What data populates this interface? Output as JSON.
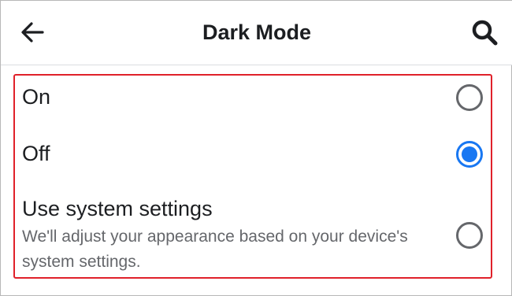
{
  "header": {
    "title": "Dark Mode",
    "back_icon": "arrow-left-icon",
    "search_icon": "search-icon"
  },
  "options": [
    {
      "label": "On",
      "description": "",
      "selected": false
    },
    {
      "label": "Off",
      "description": "",
      "selected": true
    },
    {
      "label": "Use system settings",
      "description": "We'll adjust your appearance based on your device's system settings.",
      "selected": false
    }
  ],
  "colors": {
    "accent": "#1877f2",
    "highlight_border": "#e0212a",
    "text_primary": "#1c1e21",
    "text_secondary": "#65676b"
  }
}
